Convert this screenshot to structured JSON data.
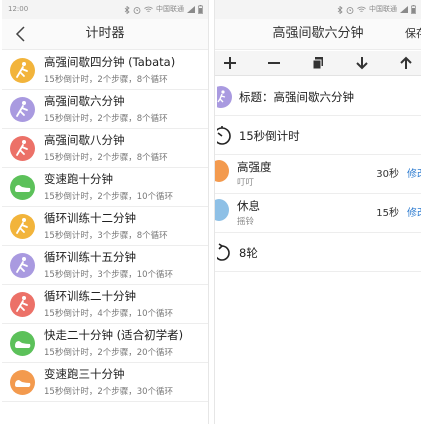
{
  "status_bar": {
    "left_time": "12:00",
    "carrier": "中国联通",
    "icons": [
      "bluetooth-icon",
      "alarm-icon",
      "wifi-icon",
      "signal-icon",
      "battery-icon"
    ]
  },
  "list_screen": {
    "title": "计时器",
    "items": [
      {
        "title": "高强间歇四分钟 (Tabata)",
        "sub": "15秒倒计时，2个步骤，8个循环",
        "icon": "running-icon",
        "color": "#f2b43b"
      },
      {
        "title": "高强间歇六分钟",
        "sub": "15秒倒计时，2个步骤，8个循环",
        "icon": "running-icon",
        "color": "#a99ae0"
      },
      {
        "title": "高强间歇八分钟",
        "sub": "15秒倒计时，2个步骤，8个循环",
        "icon": "running-icon",
        "color": "#ec7168"
      },
      {
        "title": "变速跑十分钟",
        "sub": "15秒倒计时，2个步骤，10个循环",
        "icon": "shoe-icon",
        "color": "#5cc15a"
      },
      {
        "title": "循环训练十二分钟",
        "sub": "15秒倒计时，3个步骤，8个循环",
        "icon": "running-icon",
        "color": "#f2b43b"
      },
      {
        "title": "循环训练十五分钟",
        "sub": "15秒倒计时，3个步骤，10个循环",
        "icon": "running-icon",
        "color": "#a99ae0"
      },
      {
        "title": "循环训练二十分钟",
        "sub": "15秒倒计时，4个步骤，10个循环",
        "icon": "running-icon",
        "color": "#ec7168"
      },
      {
        "title": "快走二十分钟 (适合初学者)",
        "sub": "15秒倒计时，2个步骤，20个循环",
        "icon": "shoe-icon",
        "color": "#5cc15a"
      },
      {
        "title": "变速跑三十分钟",
        "sub": "15秒倒计时，2个步骤，30个循环",
        "icon": "shoe-icon",
        "color": "#f39a4e"
      }
    ]
  },
  "editor_screen": {
    "title": "高强间歇六分钟",
    "save_label": "保存",
    "toolbar_icons": [
      "plus-icon",
      "minus-icon",
      "copy-icon",
      "arrow-down-icon",
      "arrow-up-icon"
    ],
    "name_row": "标题：高强间歇六分钟",
    "countdown_row": "15秒倒计时",
    "segments": [
      {
        "name": "高强度",
        "sound": "叮叮",
        "duration": "30秒",
        "edit": "修改",
        "color": "#f39a4e"
      },
      {
        "name": "休息",
        "sound": "摇铃",
        "duration": "15秒",
        "edit": "修改",
        "color": "#8ec0e6"
      }
    ],
    "rounds_row": "8轮",
    "accent_color": "#2f7dd1"
  }
}
